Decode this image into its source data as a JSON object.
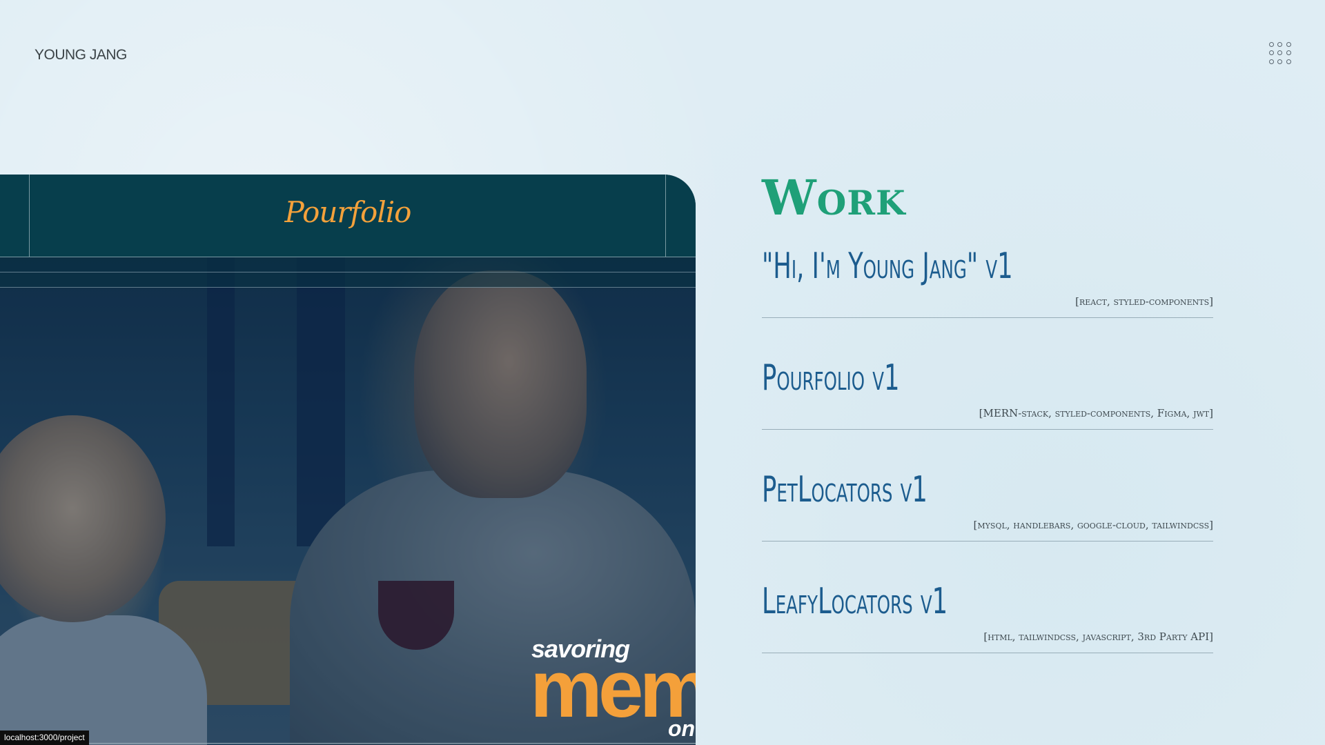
{
  "header": {
    "brand": "YOUNG JANG",
    "menu_icon": "grid-dots-icon"
  },
  "preview": {
    "logo": "Pourfolio",
    "tagline_small": "savoring",
    "tagline_big": "mem",
    "tagline_on": "on"
  },
  "work": {
    "title": "Work",
    "projects": [
      {
        "name": "\"Hi, I'm Young Jang\" v1",
        "tags": "[react, styled-components]"
      },
      {
        "name": "Pourfolio v1",
        "tags": "[MERN-stack, styled-components, Figma, jwt]"
      },
      {
        "name": "PetLocators v1",
        "tags": "[mysql, handlebars, google-cloud, tailwindcss]"
      },
      {
        "name": "LeafyLocators v1",
        "tags": "[html, tailwindcss, javascript, 3rd Party API]"
      }
    ]
  },
  "status": {
    "url": "localhost:3000/project"
  },
  "colors": {
    "background": "#dfedf4",
    "work_title": "#1fa078",
    "project_name": "#1c5c8e",
    "preview_nav": "#073e4c",
    "accent_orange": "#f4a03a"
  }
}
